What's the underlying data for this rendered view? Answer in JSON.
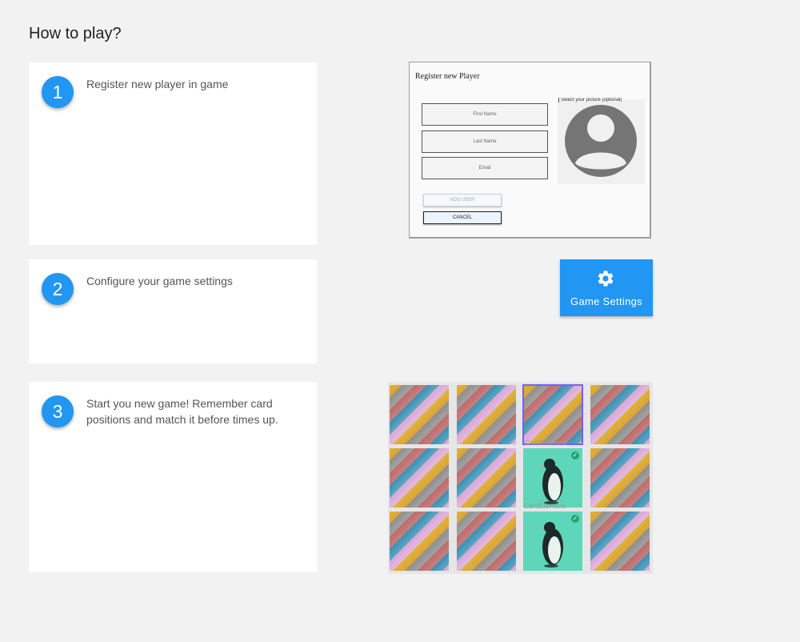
{
  "page": {
    "title": "How to play?"
  },
  "steps": [
    {
      "number": "1",
      "text": "Register new player in game"
    },
    {
      "number": "2",
      "text": "Configure your game settings"
    },
    {
      "number": "3",
      "text": "Start you new game! Remember card positions and match it before times up."
    }
  ],
  "register_preview": {
    "title": "Register new Player",
    "fields": [
      "First Name",
      "Last Name",
      "Email"
    ],
    "avatar_label": "Select your picture (optional)",
    "add_button": "ADD USER",
    "cancel_button": "CANCEL",
    "avatar_icon": "account-circle-icon"
  },
  "settings_button": {
    "label": "Game Settings",
    "icon": "gear-icon"
  },
  "game_preview": {
    "cards": [
      {
        "face": "back"
      },
      {
        "face": "back"
      },
      {
        "face": "back",
        "state": "selected"
      },
      {
        "face": "back"
      },
      {
        "face": "back"
      },
      {
        "face": "back"
      },
      {
        "face": "penguin",
        "state": "matched"
      },
      {
        "face": "back"
      },
      {
        "face": "back"
      },
      {
        "face": "back"
      },
      {
        "face": "penguin",
        "state": "matched"
      },
      {
        "face": "back"
      }
    ],
    "captions": [
      "CardElement",
      "CardElement"
    ],
    "colors": {
      "matched": "#5ed6ba",
      "selected_border": "#7b5cff",
      "check": "#21a56f"
    }
  },
  "colors": {
    "accent": "#2196f3",
    "background": "#f2f2f2"
  }
}
